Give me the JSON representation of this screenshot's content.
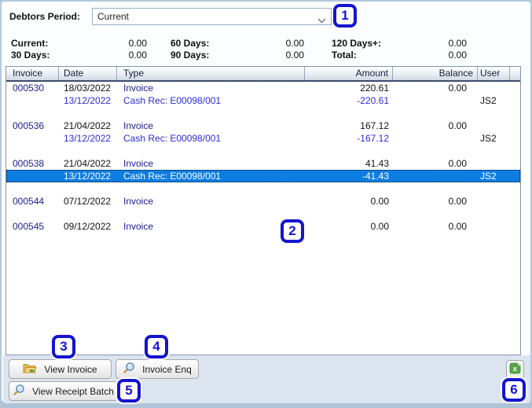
{
  "filter": {
    "label": "Debtors Period:",
    "value": "Current"
  },
  "summary": {
    "items": [
      {
        "label": "Current:",
        "value": "0.00"
      },
      {
        "label": "60 Days:",
        "value": "0.00"
      },
      {
        "label": "120 Days+:",
        "value": "0.00"
      },
      {
        "label": "30 Days:",
        "value": "0.00"
      },
      {
        "label": "90 Days:",
        "value": "0.00"
      },
      {
        "label": "Total:",
        "value": "0.00"
      }
    ]
  },
  "table": {
    "columns": [
      "Invoice",
      "Date",
      "Type",
      "Amount",
      "Balance",
      "User"
    ],
    "rows": [
      {
        "invoice": "000530",
        "date": "18/03/2022",
        "type": "Invoice",
        "amount": "220.61",
        "balance": "0.00",
        "user": ""
      },
      {
        "invoice": "",
        "date": "13/12/2022",
        "type": "Cash Rec: E00098/001",
        "amount": "-220.61",
        "balance": "",
        "user": "JS2"
      },
      {
        "invoice": "000536",
        "date": "21/04/2022",
        "type": "Invoice",
        "amount": "167.12",
        "balance": "0.00",
        "user": ""
      },
      {
        "invoice": "",
        "date": "13/12/2022",
        "type": "Cash Rec: E00098/001",
        "amount": "-167.12",
        "balance": "",
        "user": "JS2"
      },
      {
        "invoice": "000538",
        "date": "21/04/2022",
        "type": "Invoice",
        "amount": "41.43",
        "balance": "0.00",
        "user": ""
      },
      {
        "invoice": "",
        "date": "13/12/2022",
        "type": "Cash Rec: E00098/001",
        "amount": "-41.43",
        "balance": "",
        "user": "JS2"
      },
      {
        "invoice": "000544",
        "date": "07/12/2022",
        "type": "Invoice",
        "amount": "0.00",
        "balance": "0.00",
        "user": ""
      },
      {
        "invoice": "000545",
        "date": "09/12/2022",
        "type": "Invoice",
        "amount": "0.00",
        "balance": "0.00",
        "user": ""
      }
    ],
    "selected_row_index": 5
  },
  "buttons": {
    "view_invoice": "View Invoice",
    "invoice_enq": "Invoice Enq",
    "view_receipt_batch": "View Receipt Batch"
  },
  "icons": {
    "combo_chevron": "chevron-down-icon",
    "view_invoice": "folder-open-icon",
    "invoice_enq": "magnifier-icon",
    "view_receipt_batch": "magnifier-icon",
    "export": "excel-icon"
  },
  "annotations": [
    {
      "number": "1"
    },
    {
      "number": "2"
    },
    {
      "number": "3"
    },
    {
      "number": "4"
    },
    {
      "number": "5"
    },
    {
      "number": "6"
    }
  ],
  "colors": {
    "selection_blue": "#0d7de2",
    "annotation_blue": "#1414cf",
    "invoice_link_navy": "#1c1c8f",
    "cash_rec_blue": "#2b2bd6",
    "panel_blue_grey": "#dce4ef",
    "excel_green": "#58a648"
  }
}
